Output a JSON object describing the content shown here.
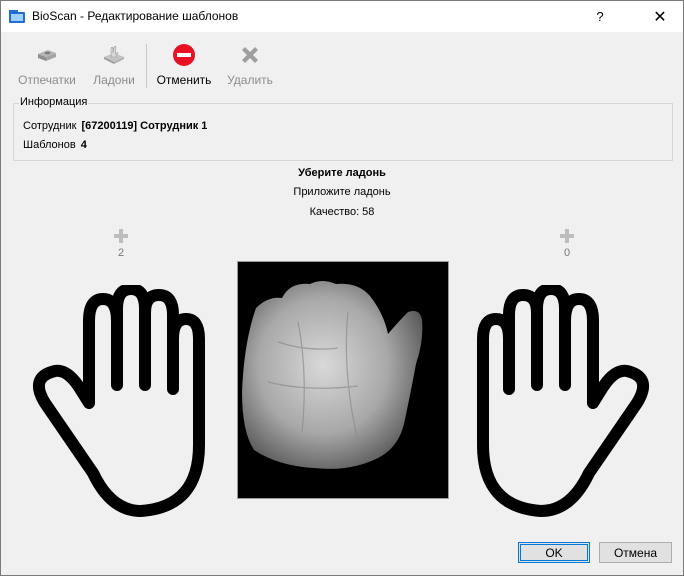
{
  "window": {
    "title": "BioScan - Редактирование шаблонов",
    "help_label": "?",
    "close_label": "✕"
  },
  "toolbar": {
    "prints_label": "Отпечатки",
    "palms_label": "Ладони",
    "cancel_label": "Отменить",
    "delete_label": "Удалить"
  },
  "info": {
    "legend": "Информация",
    "employee_label": "Сотрудник",
    "employee_value": "[67200119] Сотрудник 1",
    "templates_label": "Шаблонов",
    "templates_value": "4"
  },
  "status": {
    "line1": "Уберите ладонь",
    "line2": "Приложите ладонь",
    "quality": "Качество: 58"
  },
  "hands": {
    "left_count": "2",
    "right_count": "0"
  },
  "buttons": {
    "ok": "OK",
    "cancel": "Отмена"
  },
  "colors": {
    "accent": "#0078d7",
    "cancel_icon": "#e81123",
    "window_bg": "#f0f0f0"
  },
  "icons": {
    "app": "bioscan-app-icon",
    "prints": "fingerprint-scanner-icon",
    "palms": "palm-scanner-icon",
    "cancel": "stop-icon",
    "delete": "x-cross-icon",
    "add": "plus-icon",
    "hand": "hand-outline-icon"
  }
}
